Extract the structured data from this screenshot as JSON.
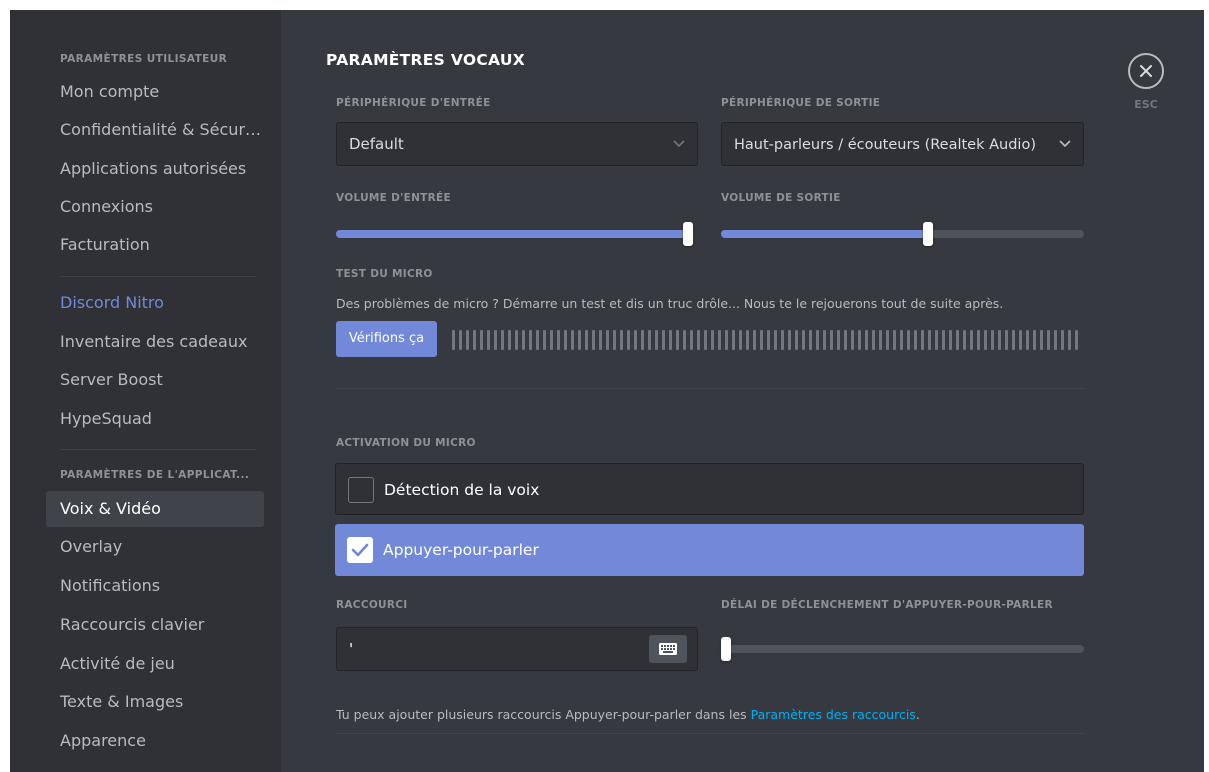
{
  "sidebar": {
    "user_settings_header": "PARAMÈTRES UTILISATEUR",
    "user_items": [
      "Mon compte",
      "Confidentialité & Sécuri...",
      "Applications autorisées",
      "Connexions",
      "Facturation"
    ],
    "nitro_items": [
      "Discord Nitro",
      "Inventaire des cadeaux",
      "Server Boost",
      "HypeSquad"
    ],
    "app_settings_header": "PARAMÈTRES DE L'APPLICAT...",
    "app_items": [
      "Voix & Vidéo",
      "Overlay",
      "Notifications",
      "Raccourcis clavier",
      "Activité de jeu",
      "Texte & Images",
      "Apparence"
    ],
    "selected": "Voix & Vidéo"
  },
  "main": {
    "title": "PARAMÈTRES VOCAUX",
    "input_device": {
      "label": "PÉRIPHÉRIQUE D'ENTRÉE",
      "value": "Default"
    },
    "output_device": {
      "label": "PÉRIPHÉRIQUE DE SORTIE",
      "value": "Haut-parleurs / écouteurs (Realtek Audio)"
    },
    "input_volume": {
      "label": "VOLUME D'ENTRÉE",
      "level": 1.0
    },
    "output_volume": {
      "label": "VOLUME DE SORTIE",
      "level": 0.57
    },
    "mic_test": {
      "label": "TEST DU MICRO",
      "description": "Des problèmes de micro ? Démarre un test et dis un truc drôle... Nous te le rejouerons tout de suite après.",
      "button": "Vérifions ça"
    },
    "input_mode": {
      "label": "ACTIVATION DU MICRO",
      "options": [
        {
          "label": "Détection de la voix",
          "checked": false
        },
        {
          "label": "Appuyer-pour-parler",
          "checked": true
        }
      ]
    },
    "shortcut": {
      "label": "RACCOURCI",
      "value": "'"
    },
    "ptt_delay": {
      "label": "DÉLAI DE DÉCLENCHEMENT D'APPUYER-POUR-PARLER",
      "level": 0.0
    },
    "footer": {
      "text": "Tu peux ajouter plusieurs raccourcis Appuyer-pour-parler dans les ",
      "link": "Paramètres des raccourcis",
      "end": "."
    },
    "close_label": "ESC"
  },
  "colors": {
    "accent": "#7289da",
    "link": "#00b0f4",
    "sidebar_bg": "#2f3136",
    "main_bg": "#36393f"
  },
  "icons": {
    "close": "close-icon",
    "chevron": "chevron-down-icon",
    "keyboard": "keyboard-icon",
    "check": "check-icon"
  }
}
